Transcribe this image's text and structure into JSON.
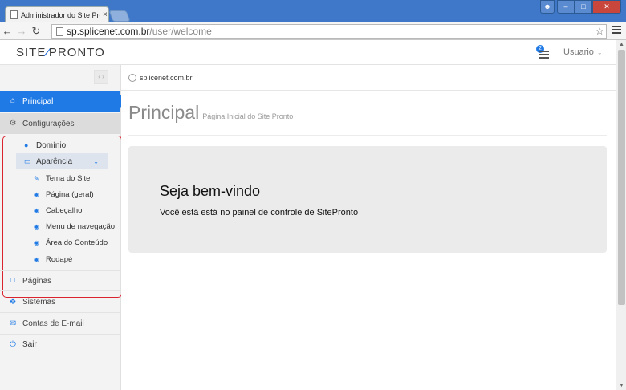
{
  "browser": {
    "tab_title": "Administrador do Site Pronto",
    "tab_close": "×",
    "url_host": "sp.splicenet.com.br",
    "url_path": "/user/welcome"
  },
  "header": {
    "logo_left": "SITE",
    "logo_right": "PRONTO",
    "notification_count": "2",
    "user_label": "Usuario"
  },
  "sidebar": {
    "items": [
      {
        "label": "Principal",
        "icon": "home-icon"
      },
      {
        "label": "Configurações",
        "icon": "gear-icon"
      },
      {
        "label": "Páginas",
        "icon": "file-icon"
      },
      {
        "label": "Sistemas",
        "icon": "puzzle-icon"
      },
      {
        "label": "Contas de E-mail",
        "icon": "envelope-icon"
      },
      {
        "label": "Sair",
        "icon": "power-icon"
      }
    ],
    "config_sub": [
      {
        "label": "Domínio",
        "icon": "globe-icon"
      },
      {
        "label": "Aparência",
        "icon": "monitor-icon"
      }
    ],
    "appearance_sub": [
      {
        "label": "Tema do Site",
        "icon": "edit-icon"
      },
      {
        "label": "Página (geral)",
        "icon": "eye-icon"
      },
      {
        "label": "Cabeçalho",
        "icon": "eye-icon"
      },
      {
        "label": "Menu de navegação",
        "icon": "eye-icon"
      },
      {
        "label": "Área do Conteúdo",
        "icon": "eye-icon"
      },
      {
        "label": "Rodapé",
        "icon": "eye-icon"
      }
    ]
  },
  "main": {
    "breadcrumb": "splicenet.com.br",
    "title": "Principal",
    "subtitle": "Página Inicial do Site Pronto",
    "welcome_heading": "Seja bem-vindo",
    "welcome_text": "Você está está no painel de controle de SitePronto"
  },
  "colors": {
    "accent": "#1f7ae6",
    "highlight_border": "#d9242f"
  }
}
